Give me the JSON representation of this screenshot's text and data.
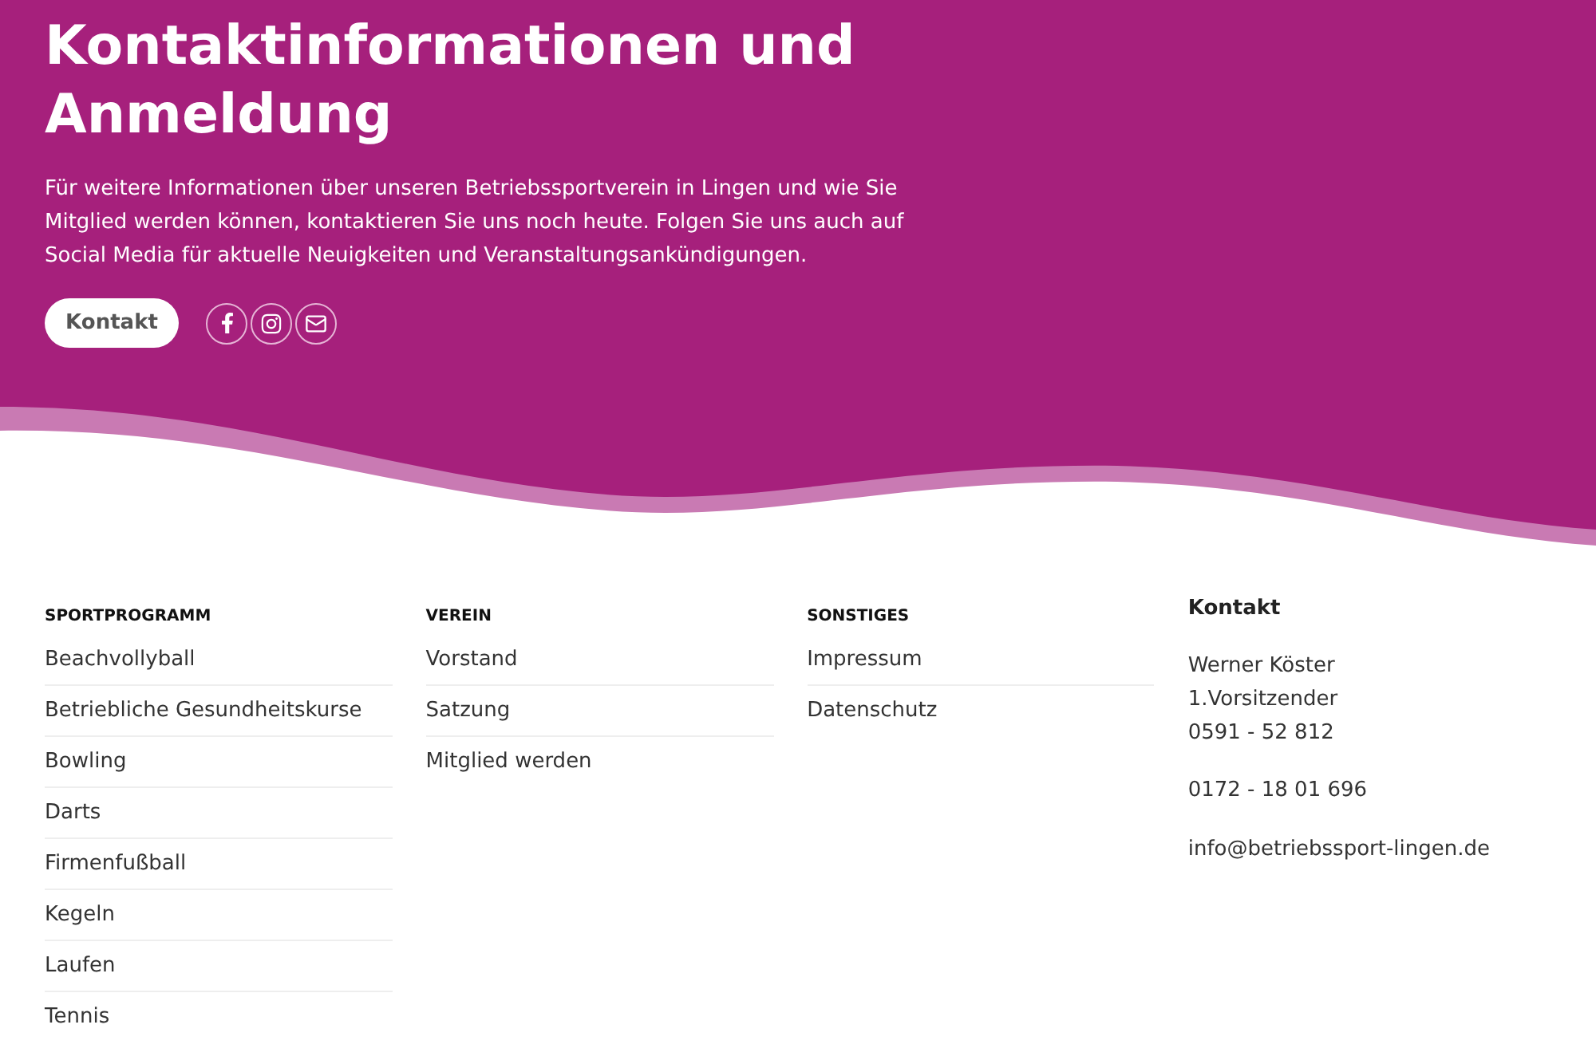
{
  "hero": {
    "title": "Kontaktinformationen und Anmeldung",
    "text": "Für weitere Informationen über unseren Betriebssportverein in Lingen und wie Sie Mitglied werden können, kontaktieren Sie uns noch heute. Folgen Sie uns auch auf Social Media für aktuelle Neuigkeiten und Veranstaltungsankündigungen.",
    "button": "Kontakt",
    "social": [
      {
        "kind": "facebook"
      },
      {
        "kind": "instagram"
      },
      {
        "kind": "mail"
      }
    ]
  },
  "footer": {
    "columns": [
      {
        "heading": "SPORTPROGRAMM",
        "links": [
          "Beachvollyball",
          "Betriebliche Gesundheitskurse",
          "Bowling",
          "Darts",
          "Firmenfußball",
          "Kegeln",
          "Laufen",
          "Tennis"
        ]
      },
      {
        "heading": "VEREIN",
        "links": [
          "Vorstand",
          "Satzung",
          "Mitglied werden"
        ]
      },
      {
        "heading": "SONSTIGES",
        "links": [
          "Impressum",
          "Datenschutz"
        ]
      }
    ],
    "contact": {
      "heading": "Kontakt",
      "name": "Werner Köster",
      "role": "1.Vorsitzender",
      "phone": "0591 - 52 812",
      "mobile": "0172 - 18 01 696",
      "email": "info@betriebssport-lingen.de"
    }
  }
}
